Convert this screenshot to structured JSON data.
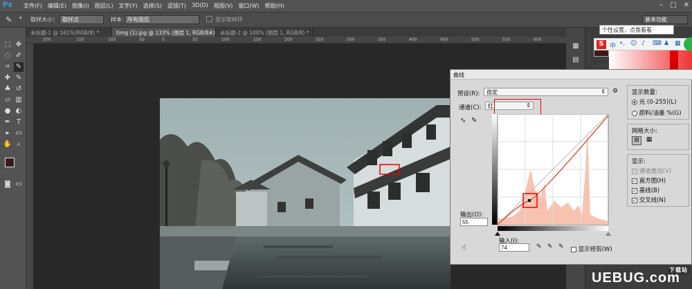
{
  "app": {
    "logo": "Ps"
  },
  "menu": [
    "文件(F)",
    "编辑(E)",
    "图像(I)",
    "图层(L)",
    "文字(Y)",
    "选择(S)",
    "滤镜(T)",
    "3D(D)",
    "视图(V)",
    "窗口(W)",
    "帮助(H)"
  ],
  "options": {
    "sample_size_label": "取样大小：",
    "sample_size_value": "取样点",
    "sample_label": "样本：",
    "sample_value": "所有图层",
    "show_ring_label": "显示取样环",
    "workspace": "基本功能"
  },
  "tabs": [
    {
      "label": "未标题-1 @ 161%(RGB/8) *"
    },
    {
      "label": "timg (1).jpg @ 133% (图层 1, RGB/8#) *"
    },
    {
      "label": "未标题-2 @ 100% (图层 1, RGB/8) *"
    }
  ],
  "ruler": [
    "200",
    "150",
    "100",
    "50",
    "0",
    "50",
    "100",
    "150",
    "200",
    "250",
    "300",
    "350",
    "400",
    "450",
    "500",
    "550",
    "600"
  ],
  "ime": {
    "tooltip": "个性设置，点我看看",
    "mode": "中"
  },
  "curves": {
    "title": "曲线",
    "preset_label": "预设(R):",
    "preset_value": "自定",
    "channel_label": "通道(C):",
    "channel_value": "红",
    "output_label": "输出(O):",
    "output_value": "55",
    "input_label": "输入(I):",
    "input_value": "74",
    "show_clipping_label": "显示修剪(W)",
    "display_amount_title": "显示数量:",
    "light_option": "光 (0-255)(L)",
    "pigment_option": "颜料/油墨 %(G)",
    "grid_size_title": "网格大小:",
    "show_title": "显示:",
    "channel_overlays": "通道叠加(V)",
    "histogram": "直方图(H)",
    "baseline": "基线(B)",
    "intersection_line": "交叉线(N)"
  },
  "watermark": {
    "brand": "UEBUG.com",
    "tag": "下载站"
  }
}
